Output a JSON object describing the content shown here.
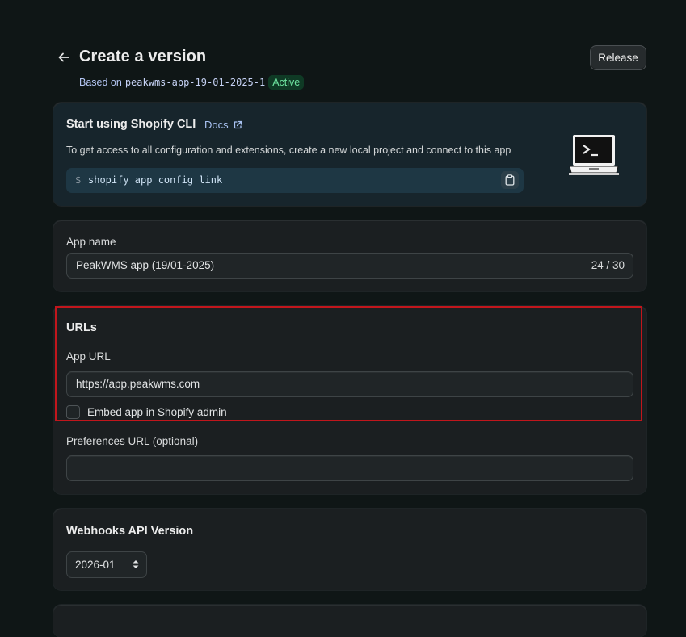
{
  "header": {
    "title": "Create a version",
    "based_on_prefix": "Based on",
    "based_on_version": "peakwms-app-19-01-2025-1",
    "status_badge": "Active",
    "release_label": "Release"
  },
  "cli_card": {
    "title": "Start using Shopify CLI",
    "docs_label": "Docs",
    "description": "To get access to all configuration and extensions, create a new local project and connect to this app",
    "prompt_symbol": "$",
    "command": "shopify app config link"
  },
  "app_name": {
    "label": "App name",
    "value": "PeakWMS app (19/01-2025)",
    "char_count": "24 / 30"
  },
  "urls": {
    "section_title": "URLs",
    "app_url_label": "App URL",
    "app_url_value": "https://app.peakwms.com",
    "embed_label": "Embed app in Shopify admin",
    "embed_checked": false,
    "preferences_label": "Preferences URL (optional)",
    "preferences_value": ""
  },
  "webhooks": {
    "section_title": "Webhooks API Version",
    "selected_version": "2026-01"
  },
  "colors": {
    "background": "#0f1616",
    "card": "#1b1f21",
    "cli_card": "#17252c",
    "badge_bg": "#0f3a25",
    "badge_text": "#6ee4a0",
    "link": "#a9c3f3",
    "highlight": "#c1161c"
  }
}
